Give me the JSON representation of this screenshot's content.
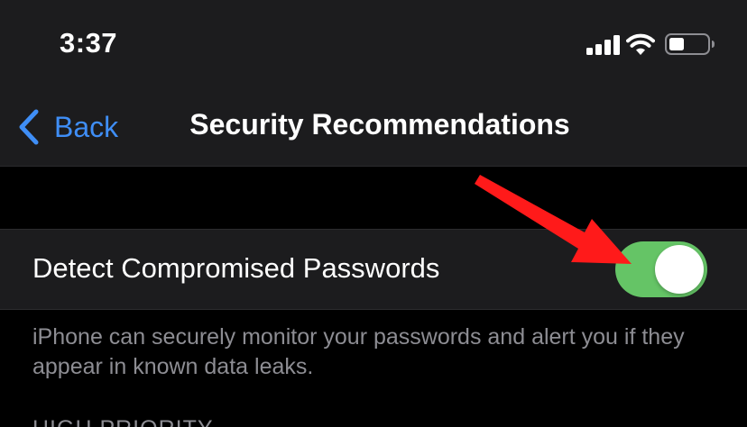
{
  "status_bar": {
    "time": "3:37",
    "icons": [
      "cellular-signal-icon",
      "wifi-icon",
      "battery-icon"
    ],
    "signal_bars": 4,
    "battery_level_percent": 40
  },
  "nav": {
    "back_label": "Back",
    "back_icon": "chevron-left-icon",
    "title": "Security Recommendations"
  },
  "setting": {
    "label": "Detect Compromised Passwords",
    "toggle_on": true
  },
  "footer": {
    "note": "iPhone can securely monitor your passwords and alert you if they appear in known data leaks."
  },
  "section": {
    "header": "HIGH PRIORITY"
  },
  "annotation": {
    "icon": "red-arrow-icon",
    "points_to": "toggle"
  },
  "colors": {
    "background": "#000000",
    "grouped_cell": "#1c1c1e",
    "accent_blue": "#3f8ef6",
    "toggle_green": "#65c466",
    "secondary_text": "#8d8d93",
    "annotation_red": "#ff1a1a"
  }
}
